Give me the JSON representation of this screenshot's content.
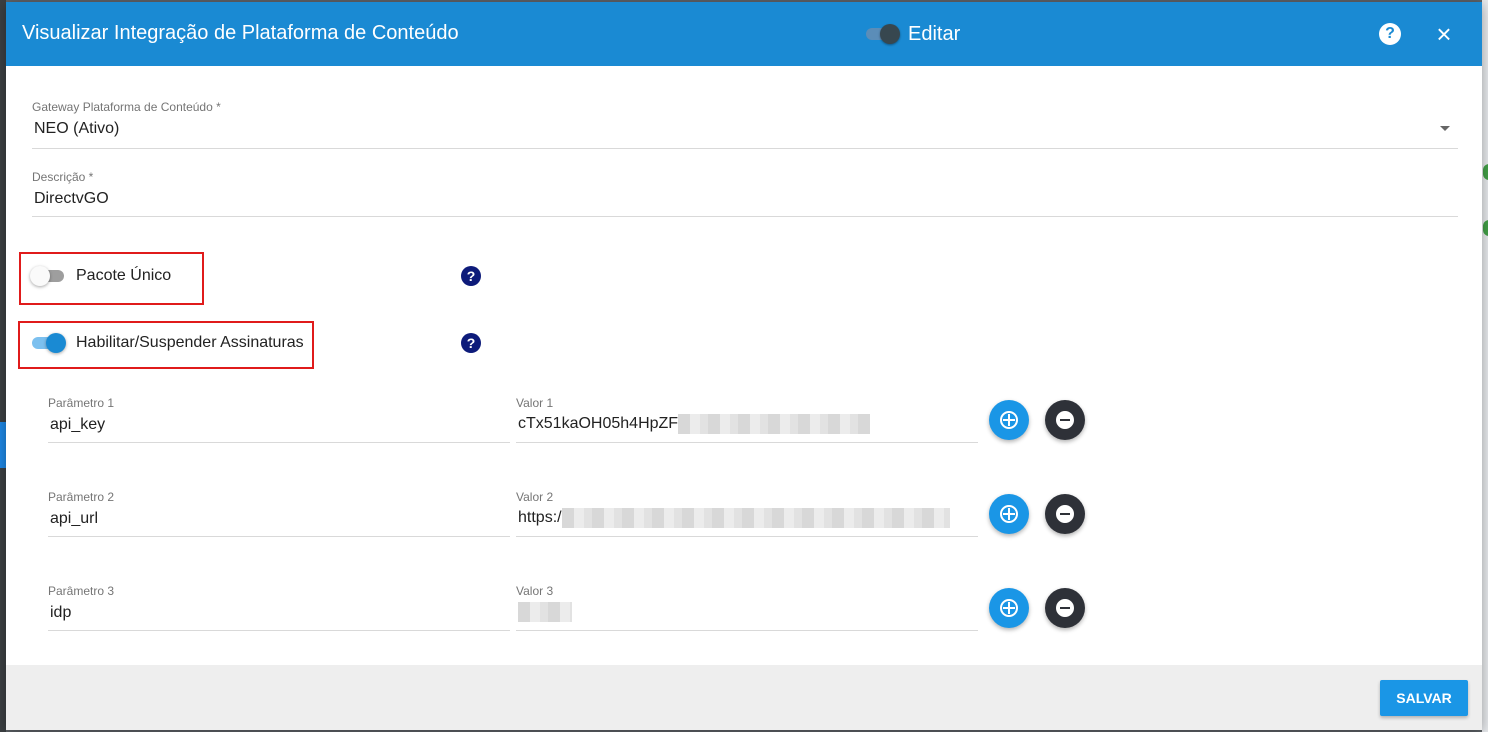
{
  "dialog": {
    "title": "Visualizar Integração de Plataforma de Conteúdo",
    "edit_label": "Editar",
    "help_icon": "?",
    "close_icon": "×"
  },
  "gateway": {
    "label": "Gateway Plataforma de Conteúdo *",
    "value": "NEO (Ativo)"
  },
  "description": {
    "label": "Descrição *",
    "value": "DirectvGO"
  },
  "toggles": {
    "pacote_unico": {
      "label": "Pacote Único",
      "enabled": false
    },
    "habilitar_suspender": {
      "label": "Habilitar/Suspender Assinaturas",
      "enabled": true
    },
    "help_icon": "?"
  },
  "params": [
    {
      "param_label": "Parâmetro 1",
      "param_value": "api_key",
      "value_label": "Valor 1",
      "value_visible": "cTx51kaOH05h4HpZF"
    },
    {
      "param_label": "Parâmetro 2",
      "param_value": "api_url",
      "value_label": "Valor 2",
      "value_visible": "https:/"
    },
    {
      "param_label": "Parâmetro 3",
      "param_value": "idp",
      "value_label": "Valor 3",
      "value_visible": ""
    }
  ],
  "footer": {
    "save_label": "SALVAR"
  },
  "colors": {
    "header": "#1a8ad3",
    "accent": "#1a96e6",
    "highlight_box": "#e01b1b"
  }
}
